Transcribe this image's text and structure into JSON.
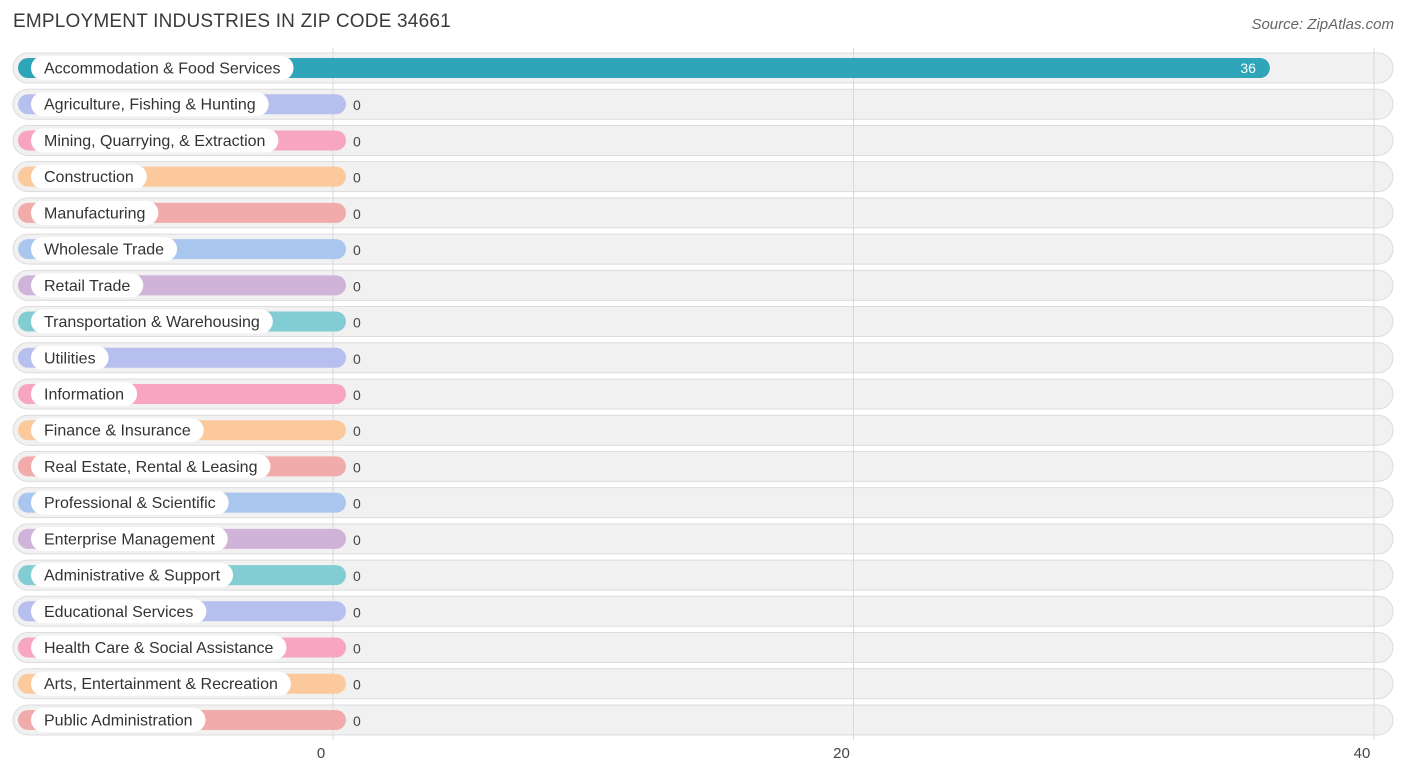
{
  "chart_data": {
    "type": "bar",
    "orientation": "horizontal",
    "title": "EMPLOYMENT INDUSTRIES IN ZIP CODE 34661",
    "source": "Source: ZipAtlas.com",
    "xlim": [
      0,
      40
    ],
    "xticks": [
      0,
      20,
      40
    ],
    "grid": true,
    "categories": [
      "Accommodation & Food Services",
      "Agriculture, Fishing & Hunting",
      "Mining, Quarrying, & Extraction",
      "Construction",
      "Manufacturing",
      "Wholesale Trade",
      "Retail Trade",
      "Transportation & Warehousing",
      "Utilities",
      "Information",
      "Finance & Insurance",
      "Real Estate, Rental & Leasing",
      "Professional & Scientific",
      "Enterprise Management",
      "Administrative & Support",
      "Educational Services",
      "Health Care & Social Assistance",
      "Arts, Entertainment & Recreation",
      "Public Administration"
    ],
    "values": [
      36,
      0,
      0,
      0,
      0,
      0,
      0,
      0,
      0,
      0,
      0,
      0,
      0,
      0,
      0,
      0,
      0,
      0,
      0
    ],
    "colors": [
      "#2ea5b8",
      "#b7bfee",
      "#f7a5c0",
      "#fcc99c",
      "#f1abab",
      "#a9c6ee",
      "#cfb3d8",
      "#82cdd3",
      "#b7bfee",
      "#f7a5c0",
      "#fcc99c",
      "#f1abab",
      "#a9c6ee",
      "#cfb3d8",
      "#82cdd3",
      "#b7bfee",
      "#f7a5c0",
      "#fcc99c",
      "#f1abab"
    ]
  }
}
